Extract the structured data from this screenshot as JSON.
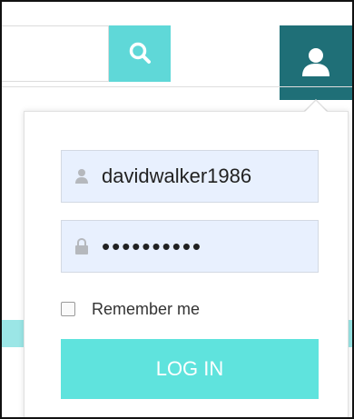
{
  "header": {
    "search": {
      "value": "",
      "placeholder": "",
      "icon": "search-icon"
    },
    "user_menu": {
      "icon": "user-icon"
    }
  },
  "login": {
    "username": {
      "value": "davidwalker1986",
      "icon": "user-icon"
    },
    "password": {
      "value": "**********",
      "icon": "lock-icon"
    },
    "remember_label": "Remember me",
    "remember_checked": false,
    "submit_label": "LOG IN"
  },
  "colors": {
    "accent": "#5fe3dd",
    "user_button": "#1f6f77",
    "field_background": "#e8f0fe"
  }
}
